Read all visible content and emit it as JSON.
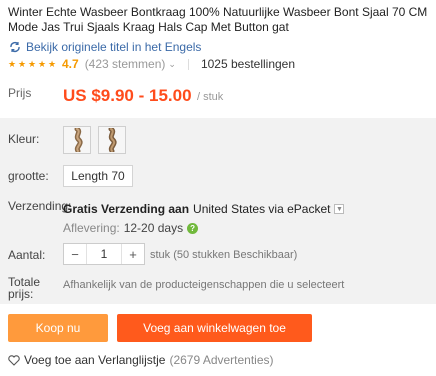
{
  "product": {
    "title": "Winter Echte Wasbeer Bontkraag 100% Natuurlijke Wasbeer Bont Sjaal 70 CM Mode Jas Trui Sjaals Kraag Hals Cap Met Button gat",
    "view_original": "Bekijk originele titel in het Engels",
    "rating": "4.7",
    "votes": "(423 stemmen)",
    "orders": "1025 bestellingen"
  },
  "price": {
    "label": "Prijs",
    "value": "US $9.90 - 15.00",
    "unit": "/ stuk"
  },
  "options": {
    "color_label": "Kleur:",
    "size_label": "grootte:",
    "size_value": "Length 70",
    "shipping_label": "Verzending:",
    "shipping_text_bold": "Gratis Verzending aan",
    "shipping_text": "United States via ePacket",
    "delivery_label": "Aflevering:",
    "delivery_value": "12-20 days",
    "quantity_label": "Aantal:",
    "quantity_value": "1",
    "quantity_minus": "−",
    "quantity_plus": "+",
    "stock": "stuk (50 stukken Beschikbaar)",
    "total_label": "Totale prijs:",
    "total_note": "Afhankelijk van de producteigenschappen die u selecteert"
  },
  "actions": {
    "buy_now": "Koop nu",
    "add_to_cart": "Voeg aan winkelwagen toe",
    "wishlist": "Voeg toe aan Verlanglijstje",
    "wishlist_count": "(2679 Advertenties)"
  },
  "colors": {
    "price": "#ff4c1c",
    "buy_button": "#ff9a3c",
    "cart_button": "#ff5a1c",
    "star": "#f59a00",
    "link": "#3b6aa8"
  }
}
